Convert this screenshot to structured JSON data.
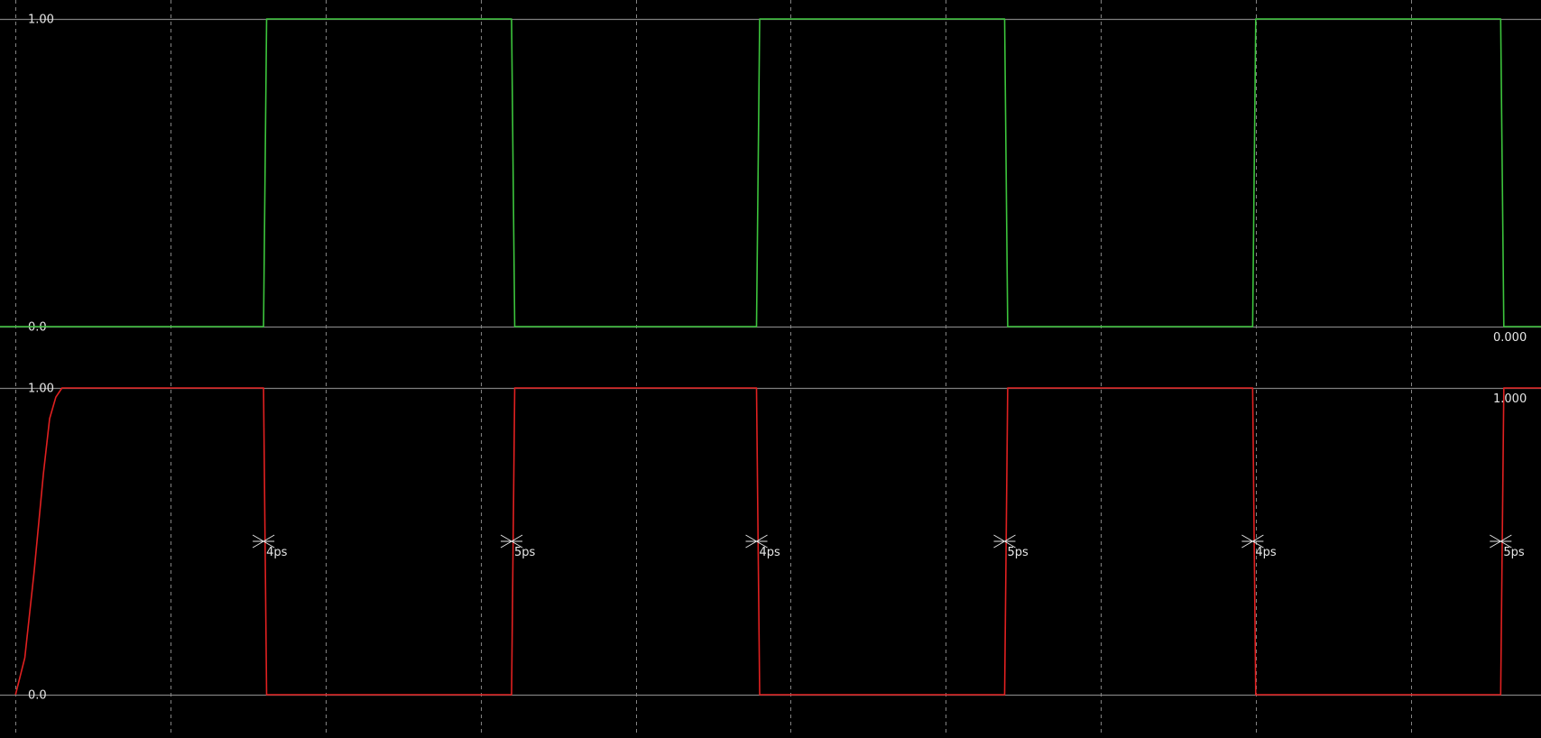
{
  "colors": {
    "background": "#000000",
    "grid": "#9a9a9a",
    "reference_line": "#808080",
    "label": "#e6e6e6",
    "trace_top": "#3cc43c",
    "trace_bottom": "#e02020",
    "marker": "#e6e6e6"
  },
  "chart_data": [
    {
      "type": "line",
      "name": "top-trace",
      "ylim": [
        0.0,
        1.0
      ],
      "y_ticks": [
        {
          "value": 1.0,
          "label": "1.00"
        },
        {
          "value": 0.0,
          "label": "0.0"
        }
      ],
      "readout": {
        "value": 0.0,
        "text": "0.000"
      },
      "x_grid": [
        0.5,
        5.5,
        10.5,
        15.5,
        20.5,
        25.5,
        30.5,
        35.5,
        40.5,
        45.5
      ],
      "xlim": [
        0,
        49.7
      ],
      "series": [
        {
          "color": "#3cc43c",
          "x": [
            0,
            8.5,
            8.6,
            16.5,
            16.6,
            24.4,
            24.5,
            32.4,
            32.5,
            40.4,
            40.5,
            48.4,
            48.5,
            49.7
          ],
          "y": [
            0,
            0,
            1,
            1,
            0,
            0,
            1,
            1,
            0,
            0,
            1,
            1,
            0,
            0
          ]
        }
      ]
    },
    {
      "type": "line",
      "name": "bottom-trace",
      "ylim": [
        0.0,
        1.0
      ],
      "y_ticks": [
        {
          "value": 1.0,
          "label": "1.00"
        },
        {
          "value": 0.0,
          "label": "0.0"
        }
      ],
      "readout": {
        "value": 1.0,
        "text": "1.000"
      },
      "x_grid": [
        0.5,
        5.5,
        10.5,
        15.5,
        20.5,
        25.5,
        30.5,
        35.5,
        40.5,
        45.5
      ],
      "xlim": [
        0,
        49.7
      ],
      "series": [
        {
          "color": "#e02020",
          "x": [
            0.5,
            0.8,
            1.1,
            1.4,
            1.6,
            1.8,
            2.0,
            2.3,
            8.5,
            8.6,
            16.5,
            16.6,
            24.4,
            24.5,
            32.4,
            32.5,
            40.4,
            40.5,
            48.4,
            48.5,
            49.7
          ],
          "y": [
            0.0,
            0.12,
            0.4,
            0.72,
            0.9,
            0.97,
            1.0,
            1.0,
            1.0,
            0.0,
            0.0,
            1.0,
            1.0,
            0.0,
            0.0,
            1.0,
            1.0,
            0.0,
            0.0,
            1.0,
            1.0
          ]
        }
      ],
      "annotations": [
        {
          "x": 8.5,
          "level": 0.5,
          "text": "4ps"
        },
        {
          "x": 16.5,
          "level": 0.5,
          "text": "5ps"
        },
        {
          "x": 24.4,
          "level": 0.5,
          "text": "4ps"
        },
        {
          "x": 32.4,
          "level": 0.5,
          "text": "5ps"
        },
        {
          "x": 40.4,
          "level": 0.5,
          "text": "4ps"
        },
        {
          "x": 48.4,
          "level": 0.5,
          "text": "5ps"
        }
      ]
    }
  ]
}
